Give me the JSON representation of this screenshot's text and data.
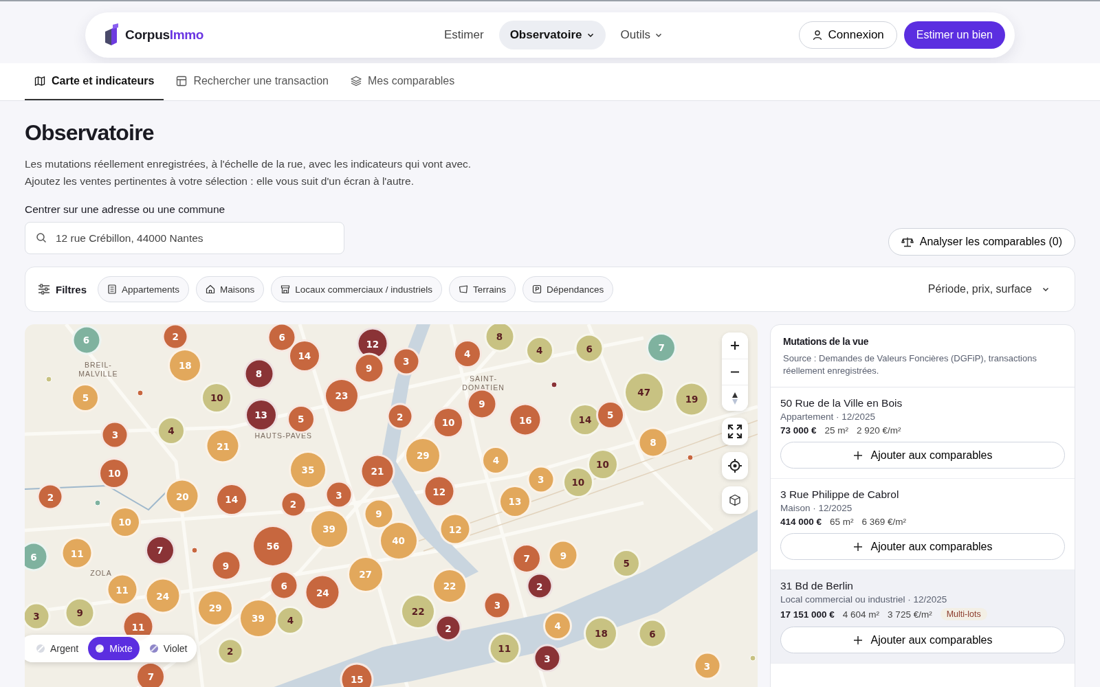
{
  "header": {
    "logo": {
      "name": "Corpus",
      "accent": "Immo"
    },
    "nav": [
      {
        "label": "Estimer",
        "selected": false,
        "has_menu": false
      },
      {
        "label": "Observatoire",
        "selected": true,
        "has_menu": true
      },
      {
        "label": "Outils",
        "selected": false,
        "has_menu": true
      }
    ],
    "login": "Connexion",
    "cta": "Estimer un bien"
  },
  "tabs": [
    {
      "label": "Carte et indicateurs",
      "selected": true,
      "kind": "map"
    },
    {
      "label": "Rechercher une transaction",
      "selected": false,
      "kind": "table"
    },
    {
      "label": "Mes comparables",
      "selected": false,
      "kind": "layers"
    }
  ],
  "page": {
    "title": "Observatoire",
    "intro": [
      "Les mutations réellement enregistrées, à l'échelle de la rue, avec les indicateurs qui vont avec.",
      "Ajoutez les ventes pertinentes à votre sélection : elle vous suit d'un écran à l'autre."
    ],
    "search": {
      "label": "Centrer sur une adresse ou une commune",
      "value": "12 rue Crébillon, 44000 Nantes"
    },
    "analyze": "Analyser les comparables (0)"
  },
  "filters": {
    "label": "Filtres",
    "chips": [
      {
        "label": "Appartements",
        "kind": "apartment",
        "selected": false
      },
      {
        "label": "Maisons",
        "kind": "house",
        "selected": false
      },
      {
        "label": "Locaux commerciaux / industriels",
        "kind": "shop",
        "selected": false
      },
      {
        "label": "Terrains",
        "kind": "land",
        "selected": false
      },
      {
        "label": "Dépendances",
        "kind": "parking",
        "selected": false
      }
    ],
    "more": "Période, prix, surface"
  },
  "map": {
    "place_labels": [
      "BREIL-\nMALVILLE",
      "HAUTS-PAVES",
      "SAINT-\nDONATIEN",
      "ZOLA"
    ],
    "clusters": [
      {
        "count": "6",
        "color": "#7fb29f"
      },
      {
        "count": "2",
        "color": "#c7673f"
      },
      {
        "count": "18",
        "color": "#e2a85c"
      },
      {
        "count": "6",
        "color": "#c7673f"
      },
      {
        "count": "14",
        "color": "#c7673f"
      },
      {
        "count": "8",
        "color": "#8a3336"
      },
      {
        "count": "12",
        "color": "#8a3336"
      },
      {
        "count": "9",
        "color": "#c7673f"
      },
      {
        "count": "3",
        "color": "#c7673f"
      },
      {
        "count": "23",
        "color": "#c7673f"
      },
      {
        "count": "4",
        "color": "#c7673f"
      },
      {
        "count": "8",
        "color": "#c8c282"
      },
      {
        "count": "4",
        "color": "#c8c282"
      },
      {
        "count": "6",
        "color": "#c8c282"
      },
      {
        "count": "7",
        "color": "#7fb29f"
      },
      {
        "count": "5",
        "color": "#e2a85c"
      },
      {
        "count": "10",
        "color": "#c8c282"
      },
      {
        "count": "13",
        "color": "#8a3336"
      },
      {
        "count": "5",
        "color": "#c7673f"
      },
      {
        "count": "2",
        "color": "#c7673f"
      },
      {
        "count": "10",
        "color": "#c7673f"
      },
      {
        "count": "9",
        "color": "#c7673f"
      },
      {
        "count": "16",
        "color": "#c7673f"
      },
      {
        "count": "14",
        "color": "#c8c282"
      },
      {
        "count": "5",
        "color": "#c7673f"
      },
      {
        "count": "47",
        "color": "#c8c282"
      },
      {
        "count": "19",
        "color": "#c8c282"
      },
      {
        "count": "3",
        "color": "#c7673f"
      },
      {
        "count": "4",
        "color": "#c8c282"
      },
      {
        "count": "21",
        "color": "#e2a85c"
      },
      {
        "count": "8",
        "color": "#e2a85c"
      },
      {
        "count": "10",
        "color": "#c7673f"
      },
      {
        "count": "35",
        "color": "#e2a85c"
      },
      {
        "count": "21",
        "color": "#c7673f"
      },
      {
        "count": "29",
        "color": "#e2a85c"
      },
      {
        "count": "4",
        "color": "#e2a85c"
      },
      {
        "count": "10",
        "color": "#c8c282"
      },
      {
        "count": "3",
        "color": "#e2a85c"
      },
      {
        "count": "10",
        "color": "#c8c282"
      },
      {
        "count": "2",
        "color": "#c7673f"
      },
      {
        "count": "20",
        "color": "#e2a85c"
      },
      {
        "count": "14",
        "color": "#c7673f"
      },
      {
        "count": "2",
        "color": "#c7673f"
      },
      {
        "count": "3",
        "color": "#c7673f"
      },
      {
        "count": "12",
        "color": "#c7673f"
      },
      {
        "count": "13",
        "color": "#e2a85c"
      },
      {
        "count": "10",
        "color": "#e2a85c"
      },
      {
        "count": "9",
        "color": "#e2a85c"
      },
      {
        "count": "39",
        "color": "#e2a85c"
      },
      {
        "count": "12",
        "color": "#e2a85c"
      },
      {
        "count": "40",
        "color": "#e2a85c"
      },
      {
        "count": "56",
        "color": "#c7673f"
      },
      {
        "count": "6",
        "color": "#7fb29f"
      },
      {
        "count": "11",
        "color": "#e2a85c"
      },
      {
        "count": "7",
        "color": "#8a3336"
      },
      {
        "count": "9",
        "color": "#c7673f"
      },
      {
        "count": "7",
        "color": "#c7673f"
      },
      {
        "count": "9",
        "color": "#e2a85c"
      },
      {
        "count": "5",
        "color": "#c8c282"
      },
      {
        "count": "27",
        "color": "#e2a85c"
      },
      {
        "count": "6",
        "color": "#c7673f"
      },
      {
        "count": "24",
        "color": "#c7673f"
      },
      {
        "count": "22",
        "color": "#e2a85c"
      },
      {
        "count": "2",
        "color": "#8a3336"
      },
      {
        "count": "11",
        "color": "#e2a85c"
      },
      {
        "count": "24",
        "color": "#e2a85c"
      },
      {
        "count": "29",
        "color": "#e2a85c"
      },
      {
        "count": "3",
        "color": "#c7673f"
      },
      {
        "count": "22",
        "color": "#c8c282"
      },
      {
        "count": "3",
        "color": "#c8c282"
      },
      {
        "count": "9",
        "color": "#c8c282"
      },
      {
        "count": "39",
        "color": "#e2a85c"
      },
      {
        "count": "4",
        "color": "#c8c282"
      },
      {
        "count": "11",
        "color": "#c7673f"
      },
      {
        "count": "2",
        "color": "#8a3336"
      },
      {
        "count": "4",
        "color": "#e2a85c"
      },
      {
        "count": "18",
        "color": "#c8c282"
      },
      {
        "count": "6",
        "color": "#c8c282"
      },
      {
        "count": "2",
        "color": "#c8c282"
      },
      {
        "count": "11",
        "color": "#c8c282"
      },
      {
        "count": "3",
        "color": "#8a3336"
      },
      {
        "count": "3",
        "color": "#e2a85c"
      },
      {
        "count": "7",
        "color": "#c7673f"
      },
      {
        "count": "15",
        "color": "#c7673f"
      }
    ],
    "styles": [
      {
        "label": "Argent",
        "selected": false,
        "kind": "silver"
      },
      {
        "label": "Mixte",
        "selected": true,
        "kind": "mixed"
      },
      {
        "label": "Violet",
        "selected": false,
        "kind": "violet"
      }
    ]
  },
  "panel": {
    "title": "Mutations de la vue",
    "source": "Source : Demandes de Valeurs Foncières (DGFiP), transactions réellement enregistrées.",
    "items": [
      {
        "address": "50 Rue de la Ville en Bois",
        "meta": "Appartement · 12/2025",
        "price": "73 000 €",
        "surface": "25 m²",
        "price_m2": "2 920 €/m²",
        "highlighted": false,
        "add": "Ajouter aux comparables"
      },
      {
        "address": "3 Rue Philippe de Cabrol",
        "meta": "Maison · 12/2025",
        "price": "414 000 €",
        "surface": "65 m²",
        "price_m2": "6 369 €/m²",
        "highlighted": false,
        "add": "Ajouter aux comparables"
      },
      {
        "address": "31 Bd de Berlin",
        "meta": "Local commercial ou industriel · 12/2025",
        "price": "17 151 000 €",
        "surface": "4 604 m²",
        "price_m2": "3 725 €/m²",
        "badge": "Multi-lots",
        "highlighted": true,
        "add": "Ajouter aux comparables"
      }
    ]
  }
}
